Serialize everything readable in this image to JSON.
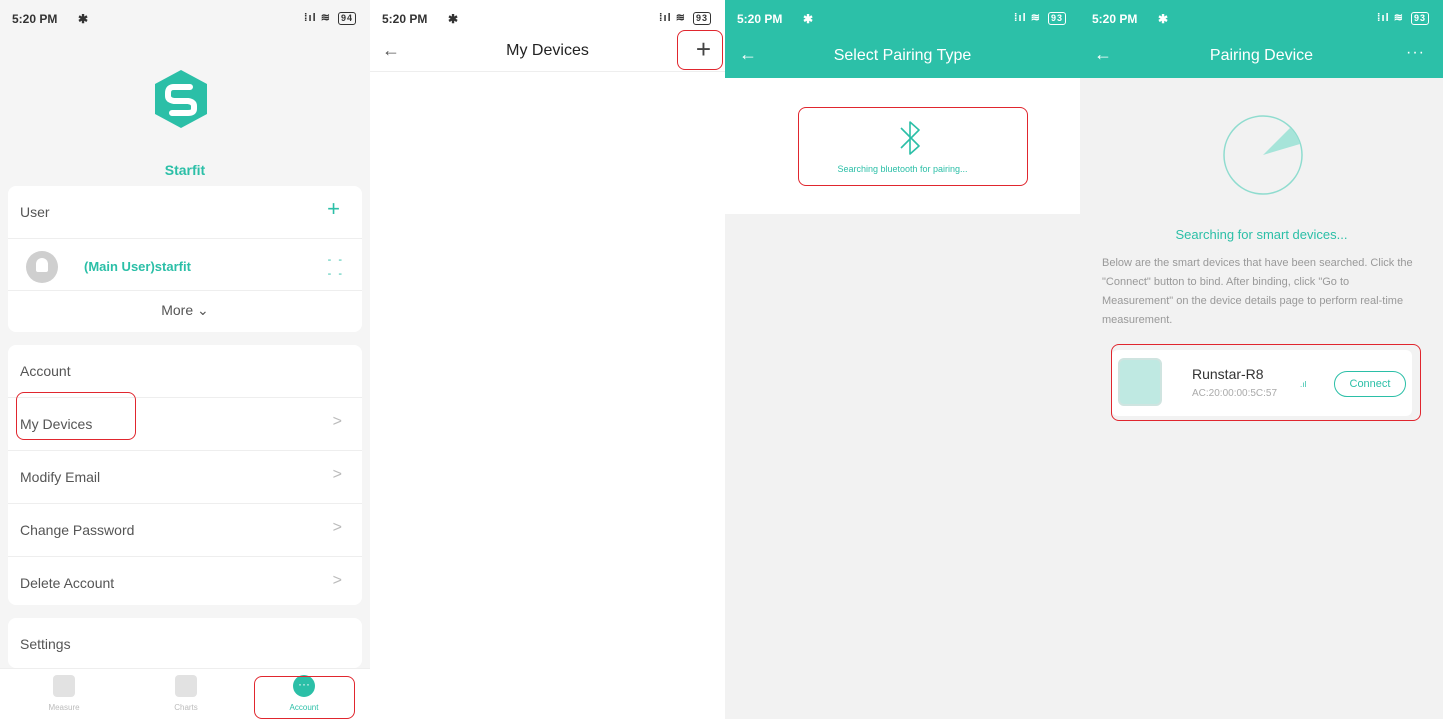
{
  "screen1": {
    "status": {
      "time": "5:20 PM",
      "bt_glyph": "✱",
      "signal_glyph": "⁞ıl",
      "wifi_glyph": "≋",
      "battery": "94"
    },
    "brand": "Starfit",
    "user_section": {
      "label": "User",
      "add_glyph": "+",
      "user_name": "(Main User)starfit",
      "user_value_line1": "- -",
      "user_value_line2": "- -",
      "more_label": "More",
      "more_glyph": "⌄"
    },
    "account_section": {
      "header": "Account",
      "items": [
        {
          "label": "My Devices"
        },
        {
          "label": "Modify Email"
        },
        {
          "label": "Change Password"
        },
        {
          "label": "Delete Account"
        }
      ],
      "chevron": ">"
    },
    "settings_label": "Settings",
    "tabs": [
      {
        "label": "Measure",
        "icon": "home-icon"
      },
      {
        "label": "Charts",
        "icon": "chart-icon"
      },
      {
        "label": "Account",
        "icon": "account-icon",
        "glyph": "···",
        "active": true
      }
    ],
    "accent_color": "#2bbfa7",
    "highlight_color": "#e0262e"
  },
  "screen2": {
    "status": {
      "time": "5:20 PM",
      "bt_glyph": "✱",
      "signal_glyph": "⁞ıl",
      "wifi_glyph": "≋",
      "battery": "93"
    },
    "back_glyph": "←",
    "title": "My Devices",
    "add_glyph": "+"
  },
  "screen3": {
    "status": {
      "time": "5:20 PM",
      "bt_glyph": "✱",
      "signal_glyph": "⁞ıl",
      "wifi_glyph": "≋",
      "battery": "93"
    },
    "back_glyph": "←",
    "title": "Select Pairing Type",
    "bluetooth_text": "Searching bluetooth for pairing..."
  },
  "screen4": {
    "status": {
      "time": "5:20 PM",
      "bt_glyph": "✱",
      "signal_glyph": "⁞ıl",
      "wifi_glyph": "≋",
      "battery": "93"
    },
    "back_glyph": "←",
    "title": "Pairing Device",
    "menu_glyph": "···",
    "searching_text": "Searching for smart devices...",
    "description": "Below are the smart devices that have been searched. Click the \"Connect\" button to bind. After binding, click \"Go to Measurement\" on the device details page to perform real-time measurement.",
    "device": {
      "name": "Runstar-R8",
      "mac": "AC:20:00:00:5C:57",
      "signal_glyph": ".ıl",
      "connect_label": "Connect"
    },
    "header_color": "#2cc0a8"
  }
}
